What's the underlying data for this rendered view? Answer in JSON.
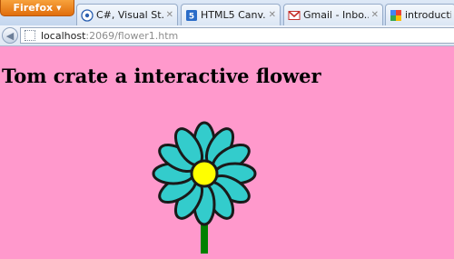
{
  "browser": {
    "menu_button": "Firefox",
    "tabs": [
      {
        "title": "C#, Visual St...",
        "favicon": "globe-icon"
      },
      {
        "title": "HTML5 Canv...",
        "favicon": "blue-square-icon"
      },
      {
        "title": "Gmail - Inbo...",
        "favicon": "gmail-icon"
      },
      {
        "title": "introduction",
        "favicon": "google-icon"
      }
    ],
    "url_host": "localhost",
    "url_rest": ":2069/flower1.htm"
  },
  "page": {
    "heading": "Tom crate a interactive flower"
  },
  "colors": {
    "page_background": "#ff99cc",
    "petal": "#33cccc",
    "center": "#ffff00",
    "stem": "#008000",
    "firefox_button": "#e8801c"
  }
}
